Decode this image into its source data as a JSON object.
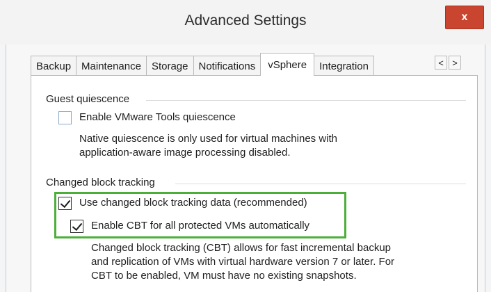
{
  "window": {
    "title": "Advanced Settings",
    "close_label": "x"
  },
  "tabs": [
    {
      "label": "Backup"
    },
    {
      "label": "Maintenance"
    },
    {
      "label": "Storage"
    },
    {
      "label": "Notifications"
    },
    {
      "label": "vSphere",
      "active": true
    },
    {
      "label": "Integration"
    }
  ],
  "tab_scroll": {
    "prev": "<",
    "next": ">"
  },
  "guest_quiescence": {
    "group_label": "Guest quiescence",
    "checkbox_label": "Enable VMware Tools quiescence",
    "checked": false,
    "description": "Native quiescence is only used for virtual machines with\napplication-aware image processing disabled."
  },
  "cbt": {
    "group_label": "Changed block tracking",
    "use_cbt_label": "Use changed block tracking data (recommended)",
    "use_cbt_checked": true,
    "enable_cbt_label": "Enable CBT for all protected VMs automatically",
    "enable_cbt_checked": true,
    "description": "Changed block tracking (CBT) allows for fast incremental backup\nand replication of VMs with virtual hardware version 7 or later. For\nCBT to be enabled, VM must have no existing snapshots."
  },
  "colors": {
    "highlight": "#4caf3a",
    "close_button": "#c9452f"
  }
}
